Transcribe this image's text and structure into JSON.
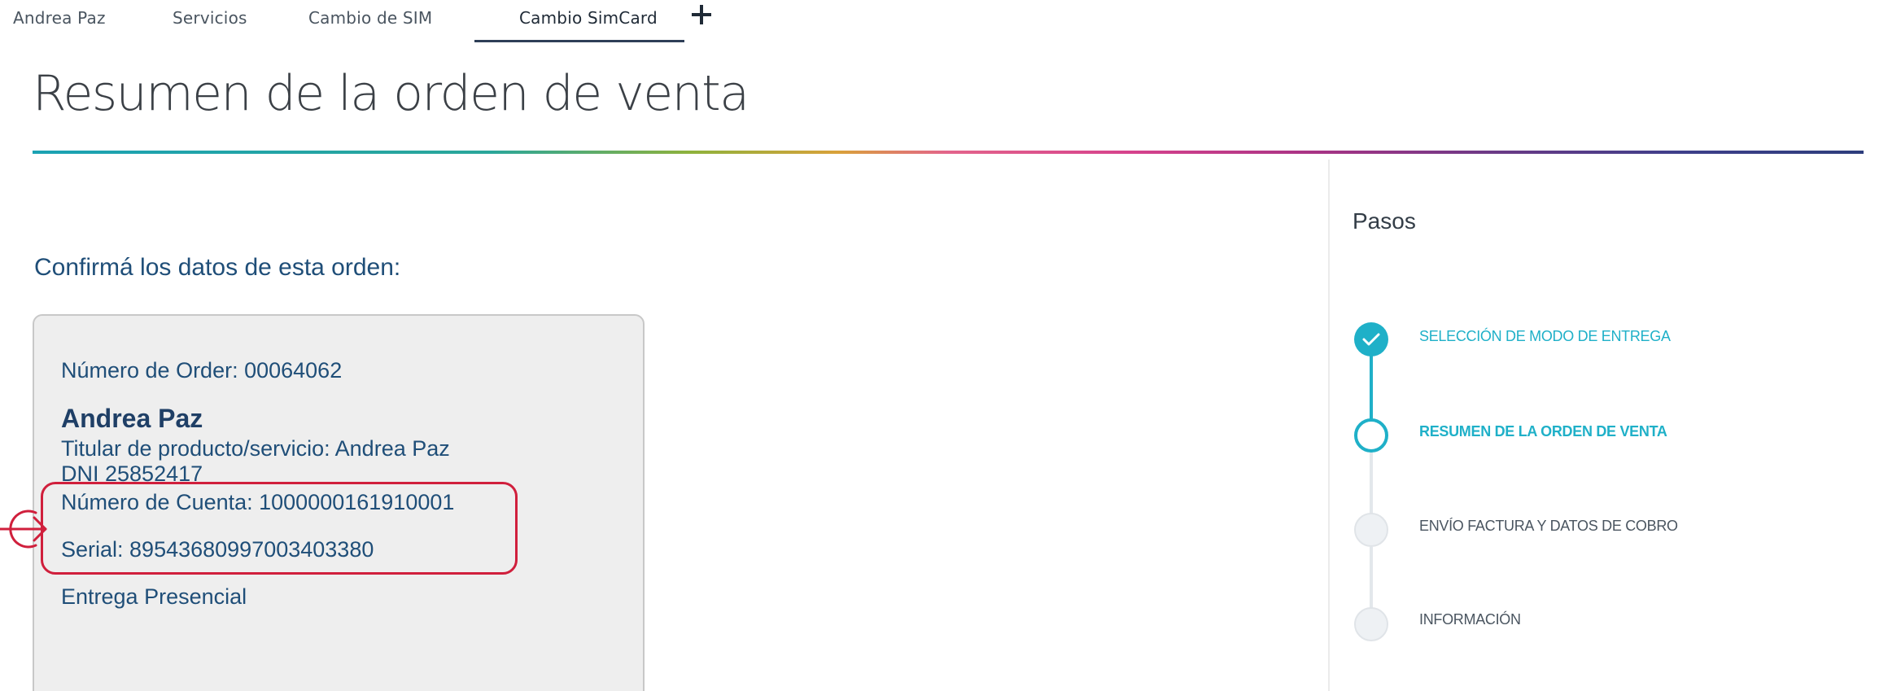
{
  "tabs": [
    {
      "label": "Andrea Paz"
    },
    {
      "label": "Servicios"
    },
    {
      "label": "Cambio de SIM"
    },
    {
      "label": "Cambio SimCard"
    }
  ],
  "page_title": "Resumen de la orden de venta",
  "confirm_label": "Confirmá los datos de esta orden:",
  "order": {
    "number_line": "Número de Order: 00064062",
    "name": "Andrea Paz",
    "titular_line": "Titular de producto/servicio: Andrea Paz",
    "dni_line": "DNI 25852417",
    "account_line": "Número de Cuenta: 1000000161910001",
    "serial_line": "Serial: 89543680997003403380",
    "delivery_line": "Entrega Presencial"
  },
  "steps": {
    "title": "Pasos",
    "items": [
      {
        "label": "SELECCIÓN DE MODO DE ENTREGA",
        "state": "completed"
      },
      {
        "label": "RESUMEN DE LA ORDEN DE VENTA",
        "state": "current"
      },
      {
        "label": "ENVÍO FACTURA Y DATOS DE COBRO",
        "state": "pending"
      },
      {
        "label": "INFORMACIÓN",
        "state": "pending"
      }
    ]
  },
  "colors": {
    "accent": "#1fb0c8",
    "highlight": "#d01f3c",
    "text_blue": "#1f4e78"
  },
  "icons": {
    "add": "plus-icon",
    "check": "check-icon",
    "callout": "arrow-right-circle-icon"
  }
}
